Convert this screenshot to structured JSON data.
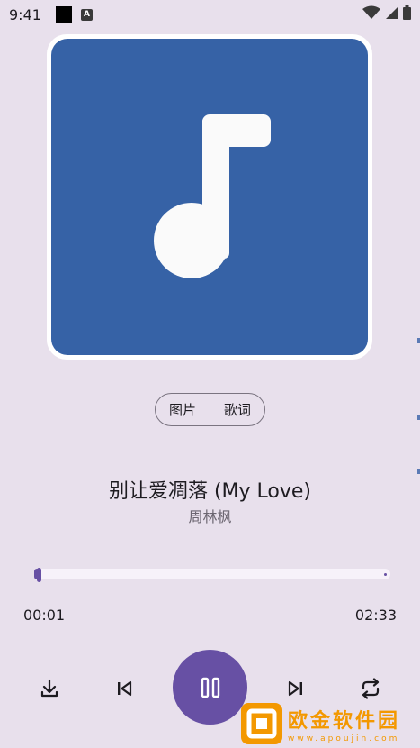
{
  "status_bar": {
    "time": "9:41",
    "notification_badge": "A"
  },
  "album": {
    "icon": "music-note-icon",
    "background_color": "#3662a6"
  },
  "view_toggle": {
    "picture_label": "图片",
    "lyrics_label": "歌词",
    "selected": "图片"
  },
  "song": {
    "title": "别让爱凋落 (My Love)",
    "artist": "周林枫"
  },
  "playback": {
    "current_time": "00:01",
    "total_time": "02:33",
    "progress_fraction": 0.01
  },
  "controls": {
    "download": "download-icon",
    "previous": "skip-previous-icon",
    "play_pause": "pause-icon",
    "next": "skip-next-icon",
    "repeat": "repeat-icon"
  },
  "watermark": {
    "main": "欧金软件园",
    "sub": "www.apoujin.com"
  },
  "colors": {
    "accent": "#6750a4",
    "background": "#e8e0ec",
    "watermark": "#f39800"
  }
}
